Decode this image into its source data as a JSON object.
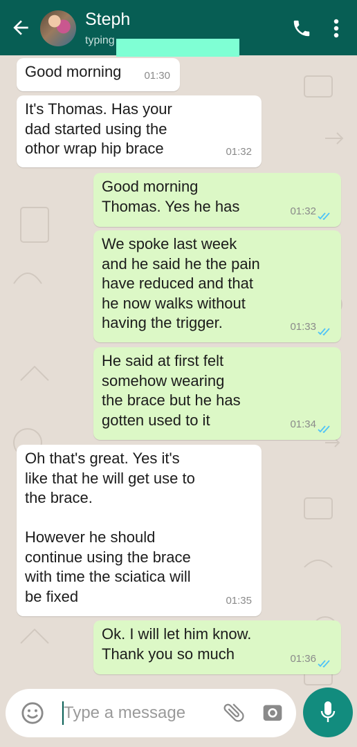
{
  "header": {
    "contact_name": "Steph",
    "status": "typing"
  },
  "messages": [
    {
      "direction": "in",
      "text": "Good morning",
      "time": "01:30"
    },
    {
      "direction": "in",
      "text": "It's Thomas. Has your\ndad started using the\nothor wrap hip brace",
      "time": "01:32"
    },
    {
      "direction": "out",
      "text": "Good morning\nThomas. Yes he has",
      "time": "01:32",
      "read": true
    },
    {
      "direction": "out",
      "text": "We spoke last week\nand he said he the pain\nhave reduced and that\nhe now walks without\nhaving the trigger.",
      "time": "01:33",
      "read": true
    },
    {
      "direction": "out",
      "text": "He said at first felt\nsomehow wearing\nthe brace but he has\ngotten used to it",
      "time": "01:34",
      "read": true
    },
    {
      "direction": "in",
      "text": "Oh that's great. Yes it's\nlike that he will get use to\nthe brace.\n\nHowever he should\ncontinue using the brace\nwith time the sciatica will\nbe fixed",
      "time": "01:35"
    },
    {
      "direction": "out",
      "text": "Ok. I will let him know.\nThank you so much",
      "time": "01:36",
      "read": true
    }
  ],
  "composer": {
    "placeholder": "Type a message"
  },
  "icons": {
    "back": "arrow-left-icon",
    "call": "phone-icon",
    "menu": "more-vert-icon",
    "emoji": "emoji-icon",
    "attach": "paperclip-icon",
    "camera": "camera-icon",
    "mic": "microphone-icon"
  },
  "colors": {
    "header": "#075e54",
    "outgoing_bubble": "#dcf8c6",
    "incoming_bubble": "#ffffff",
    "read_ticks": "#4fc3f7",
    "mic_button": "#128c7e",
    "wallpaper": "#e5ddd5"
  }
}
